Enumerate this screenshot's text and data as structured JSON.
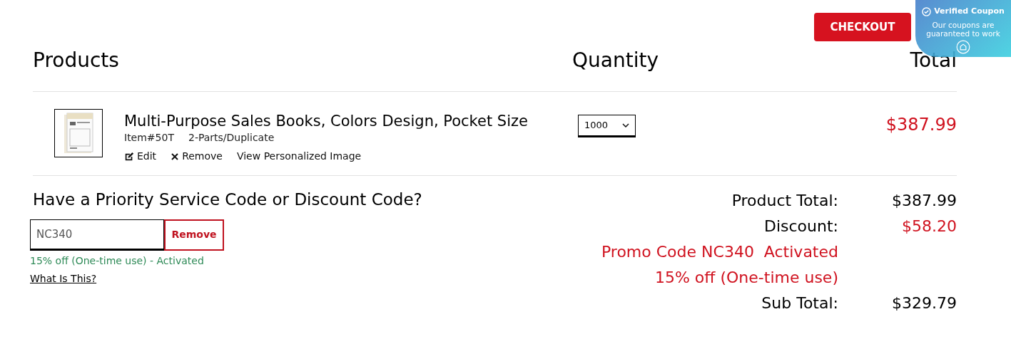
{
  "checkout_button": "CHECKOUT",
  "coupon_badge": {
    "title": "Verified Coupon",
    "text": "Our coupons are guaranteed to work"
  },
  "columns": [
    "Products",
    "Quantity",
    "Total"
  ],
  "items": [
    {
      "name": "Multi-Purpose Sales Books, Colors Design, Pocket Size",
      "item_no": "Item#50T",
      "variant": "2-Parts/Duplicate",
      "actions": [
        "Edit",
        "Remove",
        "View Personalized Image"
      ],
      "quantity": "1000",
      "total": "$387.99"
    }
  ],
  "discount": {
    "heading": "Have a Priority Service Code or Discount Code?",
    "code": "NC340",
    "button": "Remove",
    "status": "15% off (One-time use) - Activated",
    "help_link": "What Is This?"
  },
  "summary": [
    {
      "label": "Product Total:",
      "value": "$387.99",
      "kind": "plain"
    },
    {
      "label": "Discount:",
      "value": "$58.20",
      "kind": "red"
    },
    {
      "label": "Promo Code NC340  Activated",
      "kind": "note"
    },
    {
      "label": "15% off (One-time use)",
      "kind": "note"
    },
    {
      "label": "Sub Total:",
      "value": "$329.79",
      "kind": "plain"
    }
  ]
}
